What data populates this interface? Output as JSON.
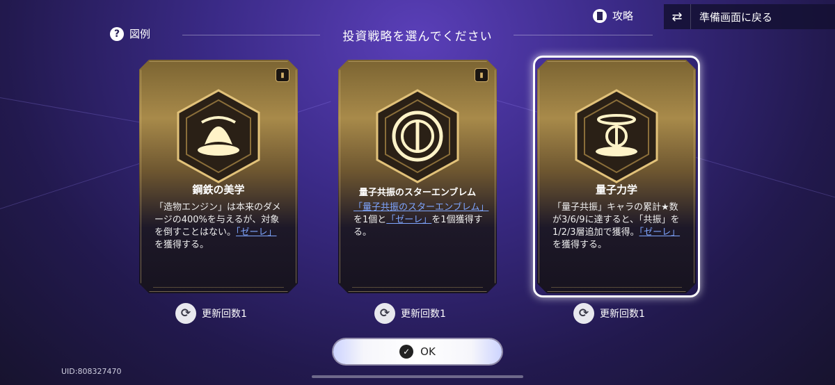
{
  "header": {
    "legend_label": "図例",
    "title": "投資戦略を選んでください",
    "guide_label": "攻略",
    "back_label": "準備画面に戻る"
  },
  "cards": [
    {
      "name": "鋼鉄の美学",
      "desc_pre": "「造物エンジン」は本来のダメージの400%を与えるが、対象を倒すことはない。",
      "desc_link": "「ゼーレ」",
      "desc_post": "を獲得する。",
      "has_book": true,
      "selected": false,
      "refresh_label": "更新回数1"
    },
    {
      "name": "量子共振のスターエンブレム",
      "desc_pre": "",
      "desc_link1": "「量子共振のスターエンブレム」",
      "desc_mid": "を1個と",
      "desc_link": "「ゼーレ」",
      "desc_post": "を1個獲得する。",
      "has_book": true,
      "selected": false,
      "refresh_label": "更新回数1"
    },
    {
      "name": "量子力学",
      "desc_pre": "「量子共振」キャラの累計★数が3/6/9に達すると、「共振」を1/2/3層追加で獲得。",
      "desc_link": "「ゼーレ」",
      "desc_post": "を獲得する。",
      "has_book": false,
      "selected": true,
      "refresh_label": "更新回数1"
    }
  ],
  "ok_label": "OK",
  "uid": "UID:808327470",
  "colors": {
    "gold": "#d2b06a",
    "link": "#7fa6ff",
    "bg_top": "#5a3fb8",
    "bg_bottom": "#17132e"
  },
  "icons": [
    "question-icon",
    "guide-book-icon",
    "swap-icon",
    "book-icon",
    "refresh-icon",
    "check-icon"
  ]
}
